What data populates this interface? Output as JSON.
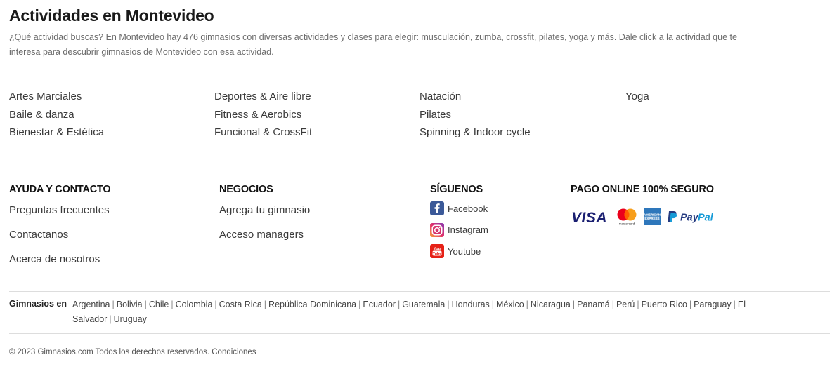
{
  "page": {
    "title": "Actividades en Montevideo",
    "description": "¿Qué actividad buscas? En Montevideo hay 476 gimnasios con diversas actividades y clases para elegir: musculación, zumba, crossfit, pilates, yoga y más. Dale click a la actividad que te interesa para descubrir gimnasios de Montevideo con esa actividad."
  },
  "activities": {
    "col1": [
      "Artes Marciales",
      "Baile & danza",
      "Bienestar & Estética"
    ],
    "col2": [
      "Deportes & Aire libre",
      "Fitness & Aerobics",
      "Funcional & CrossFit"
    ],
    "col3": [
      "Natación",
      "Pilates",
      "Spinning & Indoor cycle"
    ],
    "col4": [
      "Yoga"
    ]
  },
  "footer": {
    "help": {
      "heading": "AYUDA Y CONTACTO",
      "links": [
        "Preguntas frecuentes",
        "Contactanos",
        "Acerca de nosotros"
      ]
    },
    "business": {
      "heading": "NEGOCIOS",
      "links": [
        "Agrega tu gimnasio",
        "Acceso managers"
      ]
    },
    "social": {
      "heading": "SÍGUENOS",
      "items": [
        {
          "label": "Facebook",
          "icon": "facebook-icon",
          "color": "#3b5998"
        },
        {
          "label": "Instagram",
          "icon": "instagram-icon",
          "color": "#c13584"
        },
        {
          "label": "Youtube",
          "icon": "youtube-icon",
          "color": "#e62117"
        }
      ]
    },
    "payment": {
      "heading": "PAGO ONLINE 100% SEGURO",
      "methods": [
        {
          "name": "VISA",
          "icon": "visa-icon",
          "color": "#1a1f71"
        },
        {
          "name": "mastercard",
          "icon": "mastercard-icon",
          "color": "#eb001b"
        },
        {
          "name": "AMERICAN EXPRESS",
          "icon": "amex-icon",
          "color": "#2e77bb"
        },
        {
          "name": "PayPal",
          "icon": "paypal-icon",
          "color": "#253b80"
        }
      ]
    }
  },
  "countries": {
    "label": "Gimnasios en",
    "list": [
      "Argentina",
      "Bolivia",
      "Chile",
      "Colombia",
      "Costa Rica",
      "República Dominicana",
      "Ecuador",
      "Guatemala",
      "Honduras",
      "México",
      "Nicaragua",
      "Panamá",
      "Perú",
      "Puerto Rico",
      "Paraguay",
      "El Salvador",
      "Uruguay"
    ]
  },
  "copyright": {
    "text": "© 2023 Gimnasios.com Todos los derechos reservados.",
    "link": "Condiciones"
  }
}
